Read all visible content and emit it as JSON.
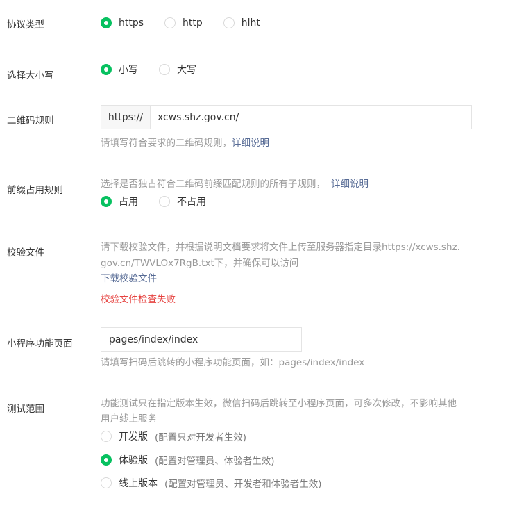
{
  "protocol": {
    "label": "协议类型",
    "options": [
      {
        "label": "https",
        "checked": true
      },
      {
        "label": "http",
        "checked": false
      },
      {
        "label": "hlht",
        "checked": false
      }
    ]
  },
  "case": {
    "label": "选择大小写",
    "options": [
      {
        "label": "小写",
        "checked": true
      },
      {
        "label": "大写",
        "checked": false
      }
    ]
  },
  "qrcode_rule": {
    "label": "二维码规则",
    "prefix": "https://",
    "value": "xcws.shz.gov.cn/",
    "hint": "请填写符合要求的二维码规则，",
    "hint_link": "详细说明"
  },
  "prefix_rule": {
    "label": "前缀占用规则",
    "hint": "选择是否独占符合二维码前缀匹配规则的所有子规则，",
    "hint_link": "详细说明",
    "options": [
      {
        "label": "占用",
        "checked": true
      },
      {
        "label": "不占用",
        "checked": false
      }
    ]
  },
  "verify_file": {
    "label": "校验文件",
    "hint_line1": "请下载校验文件，并根据说明文档要求将文件上传至服务器指定目录https://xcws.shz.",
    "hint_line2": "gov.cn/TWVLOx7RgB.txt下，并确保可以访问",
    "download_link": "下载校验文件",
    "error": "校验文件检查失败"
  },
  "page": {
    "label": "小程序功能页面",
    "value": "pages/index/index",
    "hint": "请填写扫码后跳转的小程序功能页面，如：pages/index/index"
  },
  "test_scope": {
    "label": "测试范围",
    "hint_line1": "功能测试只在指定版本生效，微信扫码后跳转至小程序页面，可多次修改，不影响其他",
    "hint_line2": "用户线上服务",
    "options": [
      {
        "label": "开发版",
        "note": "(配置只对开发者生效)",
        "checked": false
      },
      {
        "label": "体验版",
        "note": "(配置对管理员、体验者生效)",
        "checked": true
      },
      {
        "label": "线上版本",
        "note": "(配置对管理员、开发者和体验者生效)",
        "checked": false
      }
    ]
  },
  "colors": {
    "accent": "#07c160",
    "link": "#576b95",
    "error": "#e64340",
    "hint": "#9a9a9a"
  }
}
